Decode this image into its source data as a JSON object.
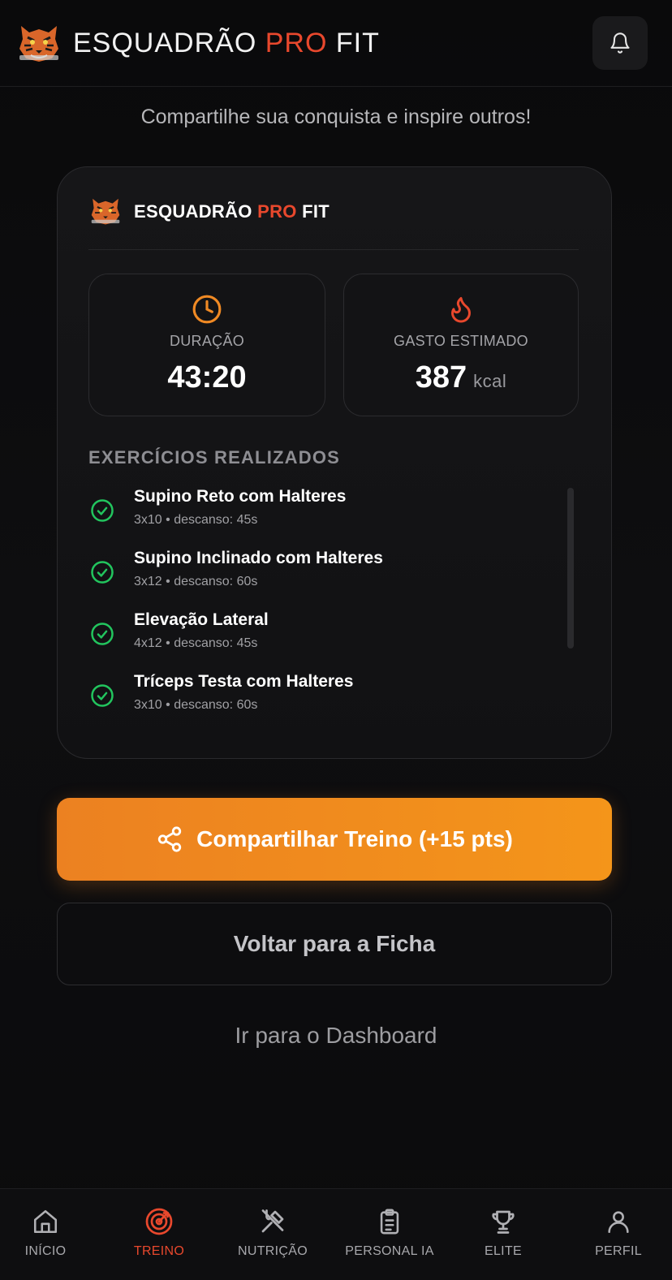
{
  "header": {
    "brand_part1": "ESQUADRÃO",
    "brand_accent": "PRO",
    "brand_part2": "FIT"
  },
  "subtitle": "Compartilhe sua conquista e inspire outros!",
  "card": {
    "brand_part1": "ESQUADRÃO",
    "brand_accent": "PRO",
    "brand_part2": "FIT",
    "duration": {
      "label": "DURAÇÃO",
      "value": "43:20",
      "icon": "clock-icon"
    },
    "calories": {
      "label": "GASTO ESTIMADO",
      "value": "387",
      "unit": "kcal",
      "icon": "flame-icon"
    },
    "exercises_title": "EXERCÍCIOS REALIZADOS",
    "exercises": [
      {
        "name": "Supino Reto com Halteres",
        "meta": "3x10 • descanso: 45s"
      },
      {
        "name": "Supino Inclinado com Halteres",
        "meta": "3x12 • descanso: 60s"
      },
      {
        "name": "Elevação Lateral",
        "meta": "4x12 • descanso: 45s"
      },
      {
        "name": "Tríceps Testa com Halteres",
        "meta": "3x10 • descanso: 60s"
      }
    ]
  },
  "buttons": {
    "share": "Compartilhar Treino (+15 pts)",
    "back": "Voltar para a Ficha",
    "dashboard": "Ir para o Dashboard"
  },
  "nav": [
    {
      "label": "INÍCIO",
      "icon": "home-icon"
    },
    {
      "label": "TREINO",
      "icon": "target-icon",
      "active": true
    },
    {
      "label": "NUTRIÇÃO",
      "icon": "utensils-icon"
    },
    {
      "label": "PERSONAL IA",
      "icon": "clipboard-icon"
    },
    {
      "label": "ELITE",
      "icon": "trophy-icon"
    },
    {
      "label": "PERFIL",
      "icon": "user-icon"
    }
  ],
  "colors": {
    "accent_red": "#e8482d",
    "accent_orange": "#f4951a",
    "success_green": "#22c55e"
  }
}
